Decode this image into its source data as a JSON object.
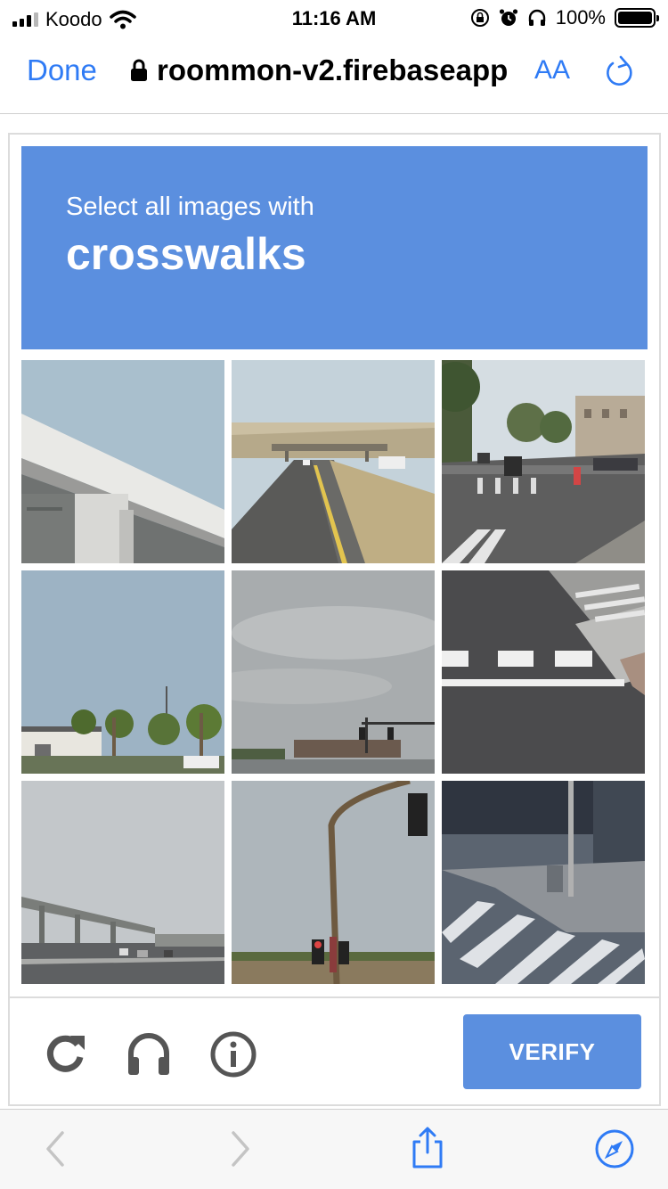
{
  "status_bar": {
    "carrier": "Koodo",
    "time": "11:16 AM",
    "battery": "100%",
    "icons": [
      "signal-icon",
      "wifi-icon",
      "rotation-lock-icon",
      "alarm-icon",
      "headphones-icon",
      "battery-icon"
    ]
  },
  "browser": {
    "done_label": "Done",
    "url": "roommon-v2.firebaseapp",
    "text_size_label": "AA",
    "accent_color": "#2f7bf5"
  },
  "captcha": {
    "header_color": "#5b8fdf",
    "prompt": "Select all images with",
    "target": "crosswalks",
    "tiles": [
      "overpass-bridge",
      "highway-with-overpass",
      "city-street-with-crosswalk",
      "palm-trees",
      "cloudy-sky-traffic-light",
      "crosswalk-markings",
      "freeway-overpass",
      "traffic-light-pole",
      "crosswalk-corner"
    ],
    "footer_icons": [
      "reload-icon",
      "headphones-icon",
      "info-icon"
    ],
    "verify_label": "VERIFY"
  },
  "bottom_toolbar": {
    "icons": [
      "back-icon",
      "forward-icon",
      "share-icon",
      "compass-icon"
    ]
  }
}
